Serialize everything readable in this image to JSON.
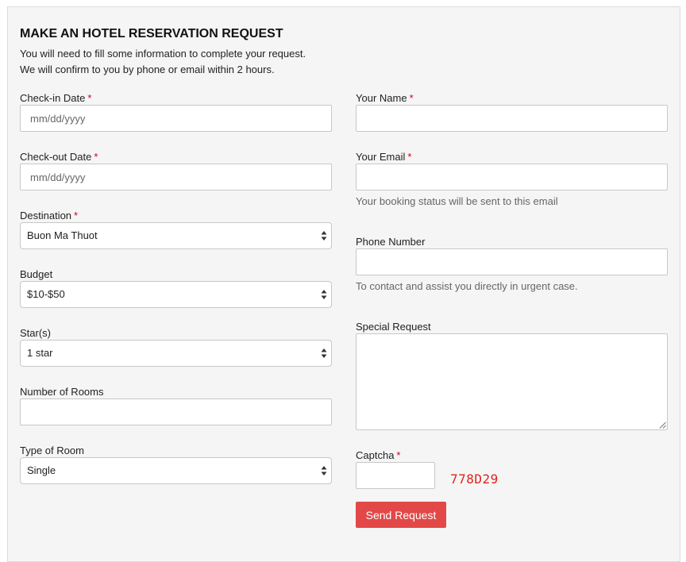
{
  "form": {
    "title": "MAKE AN HOTEL RESERVATION REQUEST",
    "intro_line1": "You will need to fill some information to complete your request.",
    "intro_line2": "We will confirm to you by phone or email within 2 hours."
  },
  "fields": {
    "checkin": {
      "label": "Check-in Date",
      "required": "*",
      "placeholder": "mm/dd/yyyy",
      "value": ""
    },
    "checkout": {
      "label": "Check-out Date",
      "required": "*",
      "placeholder": "mm/dd/yyyy",
      "value": ""
    },
    "destination": {
      "label": "Destination",
      "required": "*",
      "value": "Buon Ma Thuot"
    },
    "budget": {
      "label": "Budget",
      "value": "$10-$50"
    },
    "stars": {
      "label": "Star(s)",
      "value": "1 star"
    },
    "rooms": {
      "label": "Number of Rooms",
      "value": ""
    },
    "room_type": {
      "label": "Type of Room",
      "value": "Single"
    },
    "name": {
      "label": "Your Name",
      "required": "*",
      "value": ""
    },
    "email": {
      "label": "Your Email",
      "required": "*",
      "value": "",
      "help": "Your booking status will be sent to this email"
    },
    "phone": {
      "label": "Phone Number",
      "value": "",
      "help": "To contact and assist you directly in urgent case."
    },
    "special": {
      "label": "Special Request",
      "value": ""
    },
    "captcha": {
      "label": "Captcha",
      "required": "*",
      "value": "",
      "code": "778D29"
    }
  },
  "actions": {
    "send_label": "Send Request"
  },
  "colors": {
    "required_mark": "#d0021b",
    "captcha_code": "#e0221b",
    "button_bg": "#e34848",
    "panel_bg": "#f5f5f5"
  },
  "icons": {
    "select_arrows": "select-arrows-icon",
    "resize_grip": "resize-grip-icon"
  }
}
